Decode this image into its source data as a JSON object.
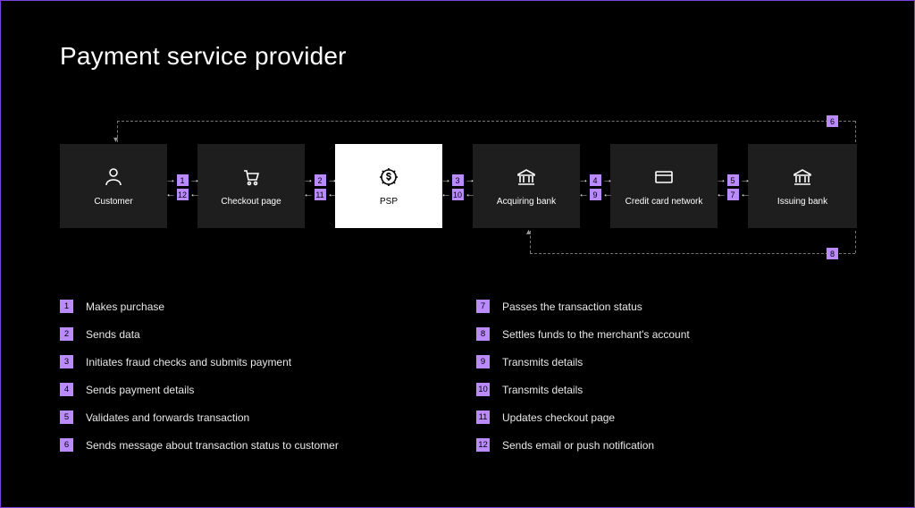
{
  "title": "Payment service provider",
  "nodes": {
    "customer": "Customer",
    "checkout": "Checkout page",
    "psp": "PSP",
    "acquiring": "Acquiring bank",
    "network": "Credit card network",
    "issuing": "Issuing bank"
  },
  "flows": {
    "g1_top": "1",
    "g1_bot": "12",
    "g2_top": "2",
    "g2_bot": "11",
    "g3_top": "3",
    "g3_bot": "10",
    "g4_top": "4",
    "g4_bot": "9",
    "g5_top": "5",
    "g5_bot": "7"
  },
  "lines": {
    "top": "6",
    "bottom": "8"
  },
  "steps": {
    "s1": "Makes purchase",
    "s2": "Sends data",
    "s3": "Initiates fraud checks and submits payment",
    "s4": "Sends payment details",
    "s5": "Validates and forwards transaction",
    "s6": "Sends message about transaction status to customer",
    "s7": "Passes the transaction status",
    "s8": "Settles funds to the merchant's account",
    "s9": "Transmits details",
    "s10": "Transmits details",
    "s11": "Updates checkout page",
    "s12": "Sends email or push notification"
  },
  "nums": {
    "n1": "1",
    "n2": "2",
    "n3": "3",
    "n4": "4",
    "n5": "5",
    "n6": "6",
    "n7": "7",
    "n8": "8",
    "n9": "9",
    "n10": "10",
    "n11": "11",
    "n12": "12"
  }
}
